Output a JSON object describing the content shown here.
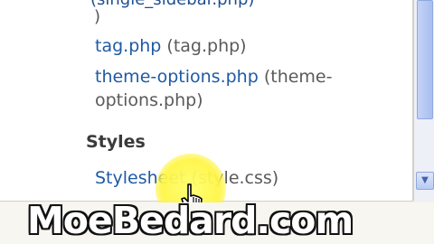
{
  "file_list": {
    "partial_line": "(single_sidebar.php)",
    "paren_close": ")",
    "templates": [
      {
        "link": "tag.php",
        "desc": "(tag.php)"
      },
      {
        "link": "theme-options.php",
        "desc": "(theme-"
      },
      {
        "link": "",
        "desc": "options.php)"
      }
    ]
  },
  "styles_section": {
    "heading": "Styles",
    "item_link": "Stylesheet",
    "item_desc": "(style.css)"
  },
  "scrollbar": {
    "down_arrow_icon": "chevron-down-icon"
  },
  "cursor": {
    "icon": "hand-pointer-icon",
    "highlight_color": "#fff55a"
  },
  "watermark": {
    "text": "MoeBedard.com"
  },
  "colors": {
    "link": "#1f5aa5",
    "desc": "#5a5a5a",
    "heading": "#3a3a3a"
  }
}
